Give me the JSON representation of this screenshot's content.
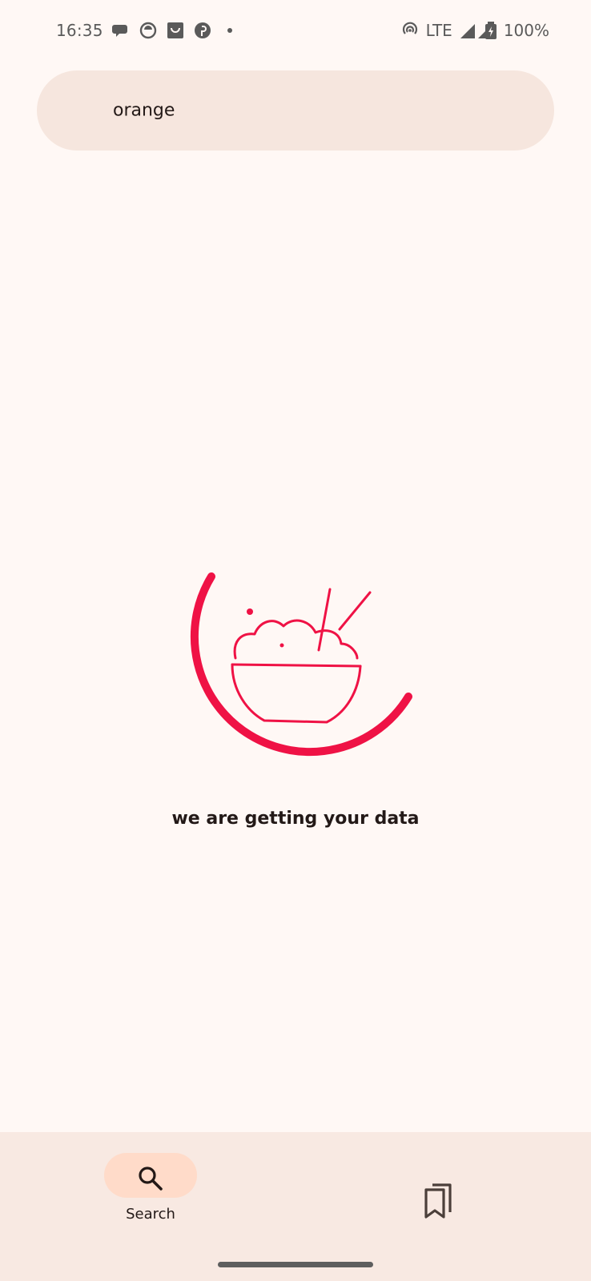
{
  "status_bar": {
    "time": "16:35",
    "network": "LTE",
    "battery": "100%",
    "notification_icons": [
      "messages-icon",
      "app-icon",
      "shop-icon",
      "pinterest-icon",
      "dot-icon"
    ],
    "right_icons": [
      "hotspot-icon",
      "signal-icon",
      "battery-icon"
    ]
  },
  "search": {
    "value": "orange"
  },
  "loader": {
    "message": "we are getting your data",
    "icon": "rice-bowl-icon",
    "accent_color": "#EF1245"
  },
  "bottom_nav": {
    "items": [
      {
        "label": "Search",
        "icon": "search-icon",
        "selected": true
      },
      {
        "label": "",
        "icon": "bookmarks-icon",
        "selected": false
      }
    ]
  },
  "colors": {
    "background": "#FFF8F5",
    "search_bar": "#F6E6DE",
    "nav_background": "#F8E9E2",
    "nav_active_pill": "#FFDBC9",
    "text": "#231917"
  }
}
